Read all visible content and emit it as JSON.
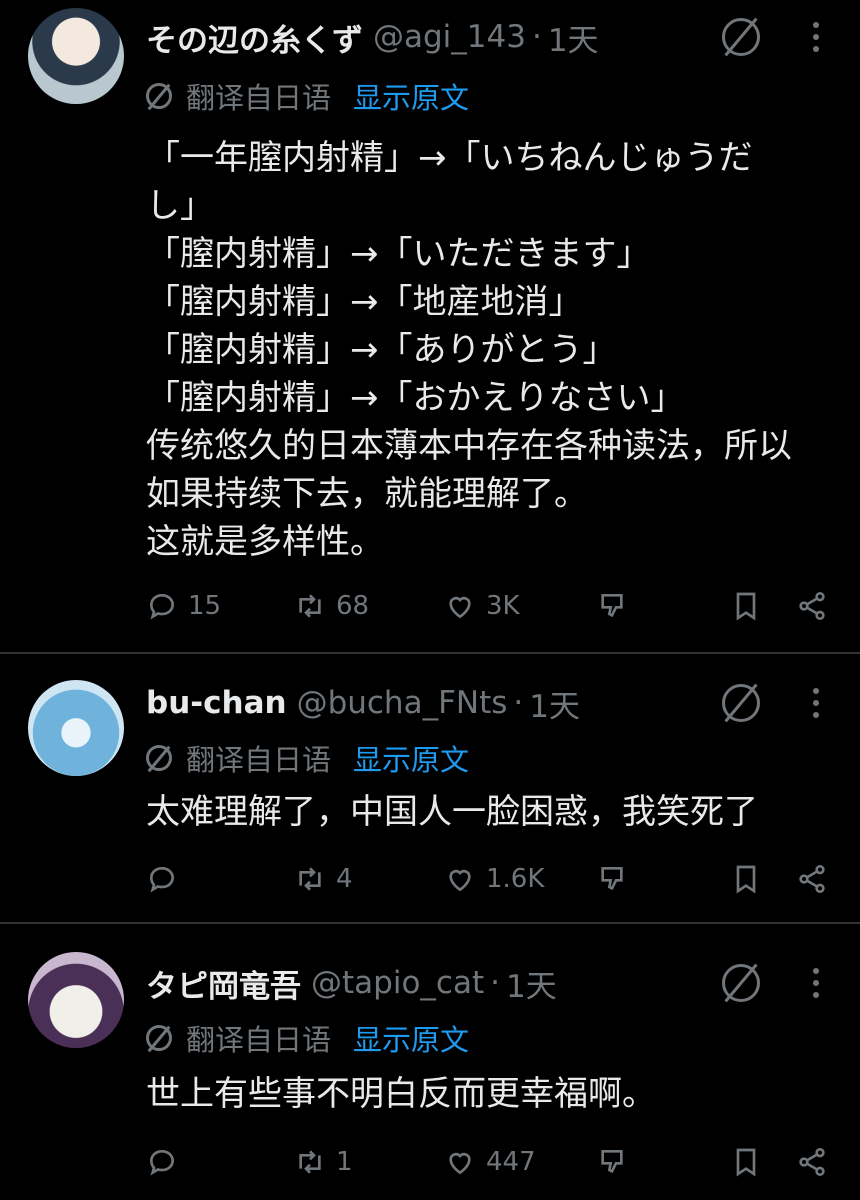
{
  "tweets": [
    {
      "name": "その辺の糸くず",
      "handle": "@agi_143",
      "time": "1天",
      "translate_label": "翻译自日语",
      "translate_link": "显示原文",
      "lines": [
        "「一年膣内射精」→「いちねんじゅうだ",
        "し」",
        "「膣内射精」→「いただきます」",
        "「膣内射精」→「地産地消」",
        "「膣内射精」→「ありがとう」",
        "「膣内射精」→「おかえりなさい」",
        "传统悠久的日本薄本中存在各种读法，所以",
        "如果持续下去，就能理解了。",
        "这就是多样性。"
      ],
      "replies": "15",
      "retweets": "68",
      "likes": "3K"
    },
    {
      "name": "bu-chan",
      "handle": "@bucha_FNts",
      "time": "1天",
      "translate_label": "翻译自日语",
      "translate_link": "显示原文",
      "lines": [
        "太难理解了，中国人一脸困惑，我笑死了"
      ],
      "replies": "",
      "retweets": "4",
      "likes": "1.6K"
    },
    {
      "name": "タピ岡竜吾",
      "handle": "@tapio_cat",
      "time": "1天",
      "translate_label": "翻译自日语",
      "translate_link": "显示原文",
      "lines": [
        "世上有些事不明白反而更幸福啊。"
      ],
      "replies": "",
      "retweets": "1",
      "likes": "447"
    }
  ],
  "icons": {
    "reply": "reply-icon",
    "retweet": "retweet-icon",
    "like": "heart-icon",
    "downvote": "downvote-icon",
    "bookmark": "bookmark-icon",
    "share": "share-icon",
    "grok": "grok-icon",
    "more": "more-icon"
  },
  "colors": {
    "background": "#000000",
    "text": "#e7e9ea",
    "muted": "#71767b",
    "link": "#1d9bf0",
    "divider": "#2f3336"
  }
}
